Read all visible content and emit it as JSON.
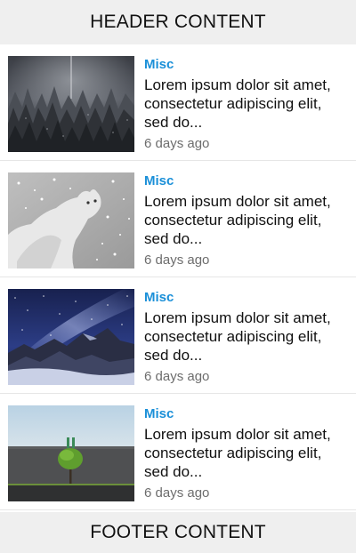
{
  "header": {
    "label": "HEADER CONTENT"
  },
  "footer": {
    "label": "FOOTER CONTENT"
  },
  "items": [
    {
      "category": "Misc",
      "title_lines": [
        "Lorem ipsum dolor sit amet,",
        "consectetur adipiscing elit,",
        "sed do..."
      ],
      "time": "6 days ago",
      "image": "foggy-forest-image"
    },
    {
      "category": "Misc",
      "title_lines": [
        "Lorem ipsum dolor sit amet,",
        "consectetur adipiscing elit,",
        "sed do..."
      ],
      "time": "6 days ago",
      "image": "snow-cat-image"
    },
    {
      "category": "Misc",
      "title_lines": [
        "Lorem ipsum dolor sit amet,",
        "consectetur adipiscing elit,",
        "sed do..."
      ],
      "time": "6 days ago",
      "image": "night-sky-mountains-image"
    },
    {
      "category": "Misc",
      "title_lines": [
        "Lorem ipsum dolor sit amet,",
        "consectetur adipiscing elit,",
        "sed do..."
      ],
      "time": "6 days ago",
      "image": "tree-by-wall-image"
    }
  ],
  "colors": {
    "header_bg": "#efefef",
    "category": "#1a8fd8",
    "time": "#6d6d6d"
  }
}
